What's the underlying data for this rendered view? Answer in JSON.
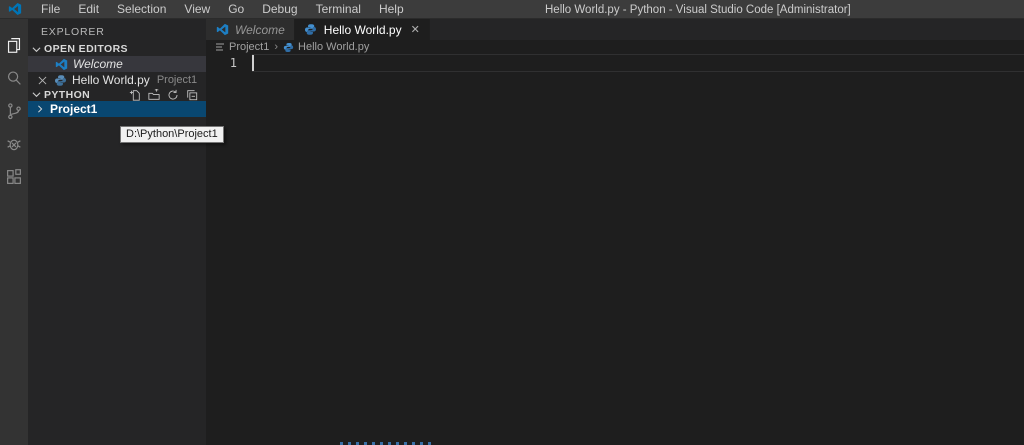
{
  "window": {
    "title": "Hello World.py - Python - Visual Studio Code [Administrator]"
  },
  "menubar": {
    "items": [
      "File",
      "Edit",
      "Selection",
      "View",
      "Go",
      "Debug",
      "Terminal",
      "Help"
    ]
  },
  "activity_bar": {
    "items": [
      "explorer",
      "search",
      "source-control",
      "debug",
      "extensions"
    ]
  },
  "sidebar": {
    "title": "EXPLORER",
    "open_editors": {
      "label": "OPEN EDITORS",
      "items": [
        {
          "label": "Welcome"
        },
        {
          "label": "Hello World.py",
          "detail": "Project1"
        }
      ]
    },
    "section": {
      "label": "PYTHON",
      "actions": [
        "new-file",
        "new-folder",
        "refresh",
        "collapse-all"
      ],
      "items": [
        {
          "label": "Project1"
        }
      ]
    }
  },
  "tooltip": {
    "text": "D:\\Python\\Project1"
  },
  "tabs": [
    {
      "label": "Welcome",
      "active": false
    },
    {
      "label": "Hello World.py",
      "active": true,
      "close": "✕"
    }
  ],
  "breadcrumb": {
    "items": [
      "Project1",
      "Hello World.py"
    ],
    "separator": "›"
  },
  "editor": {
    "line_number": "1"
  },
  "glyphs": {
    "close": "✕",
    "chevron_right": "›"
  },
  "colors": {
    "titlebar": "#3c3c3c",
    "activitybar": "#333333",
    "sidebar": "#252526",
    "editor": "#1e1e1e",
    "tab_inactive": "#2d2d2d",
    "selection": "#094771",
    "inactive_selection": "#37373d",
    "accent_blue": "#0075b7"
  }
}
